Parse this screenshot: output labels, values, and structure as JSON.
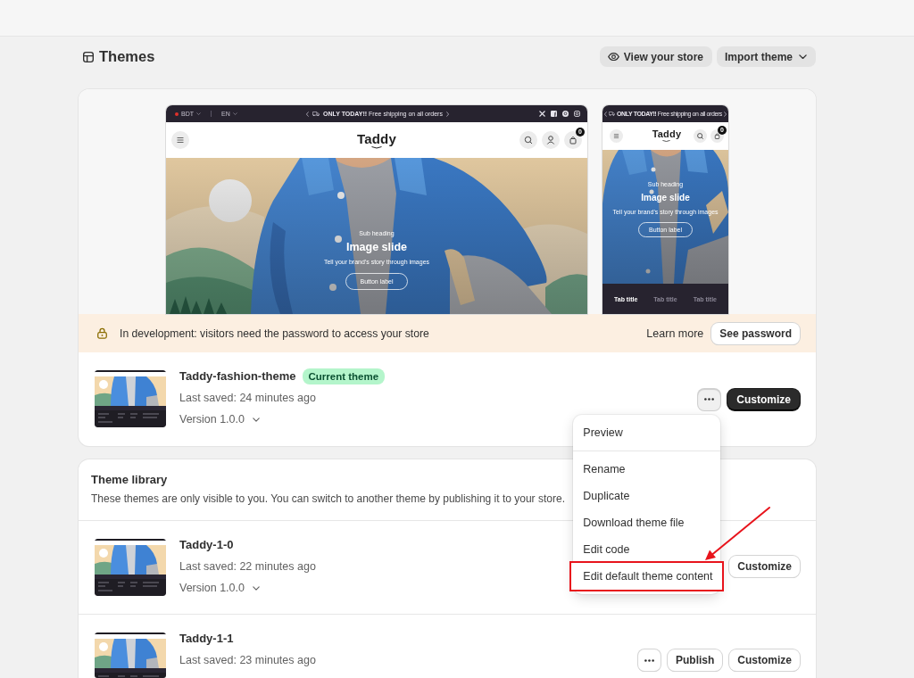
{
  "page": {
    "title": "Themes",
    "view_store_button": "View your store",
    "import_button": "Import theme"
  },
  "preview": {
    "desktop": {
      "currency": "BDT",
      "language": "EN",
      "announcement": "**ONLY TODAY!!** Free shipping on all orders",
      "logo": "Taddy",
      "cart_count": "0",
      "slide": {
        "subheading": "Sub heading",
        "heading": "Image slide",
        "text": "Tell your brand's story through images",
        "button": "Button label"
      }
    },
    "mobile": {
      "announcement": "**ONLY TODAY!!** Free shipping on all orders",
      "logo": "Taddy",
      "cart_count": "0",
      "slide": {
        "subheading": "Sub heading",
        "heading": "Image slide",
        "text": "Tell your brand's story through images",
        "button": "Button label"
      },
      "tabs": [
        {
          "label": "Tab title",
          "selected": true
        },
        {
          "label": "Tab title",
          "selected": false
        },
        {
          "label": "Tab title",
          "selected": false
        }
      ]
    }
  },
  "banner": {
    "message": "In development: visitors need the password to access your store",
    "link": "Learn more",
    "button": "See password"
  },
  "current_theme": {
    "name": "Taddy-fashion-theme",
    "badge": "Current theme",
    "saved": "Last saved: 24 minutes ago",
    "version": "Version 1.0.0",
    "customize_button": "Customize",
    "menu": {
      "open": true,
      "sections": [
        {
          "items": [
            {
              "label": "Preview",
              "highlighted": false
            }
          ]
        },
        {
          "items": [
            {
              "label": "Rename",
              "highlighted": false
            },
            {
              "label": "Duplicate",
              "highlighted": false
            },
            {
              "label": "Download theme file",
              "highlighted": false
            },
            {
              "label": "Edit code",
              "highlighted": false
            },
            {
              "label": "Edit default theme content",
              "highlighted": true
            }
          ]
        }
      ]
    }
  },
  "library": {
    "title": "Theme library",
    "description": "These themes are only visible to you. You can switch to another theme by publishing it to your store.",
    "themes": [
      {
        "name": "Taddy-1-0",
        "saved": "Last saved: 22 minutes ago",
        "version": "Version 1.0.0",
        "customize_button": "Customize"
      },
      {
        "name": "Taddy-1-1",
        "saved": "Last saved: 23 minutes ago",
        "more_button": true,
        "publish_button": "Publish",
        "customize_button": "Customize"
      }
    ]
  }
}
